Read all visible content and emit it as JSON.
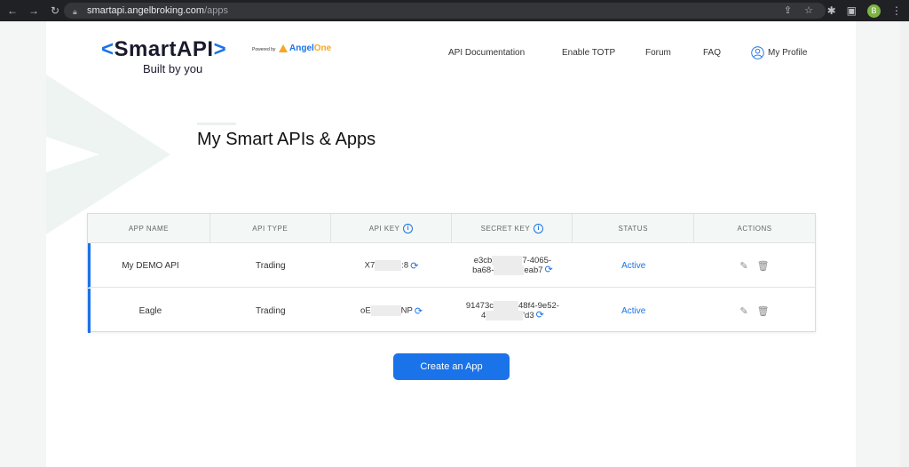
{
  "browser": {
    "url_host": "smartapi.angelbroking.com",
    "url_path": "/apps",
    "profile_initial": "B"
  },
  "logo": {
    "open_bracket": "<",
    "brand_smart": "Smart",
    "brand_api": "API",
    "close_bracket": ">",
    "tagline": "Built by you",
    "powered_by": "Powered by",
    "angel_part1": "Angel",
    "angel_part2": "One"
  },
  "nav": {
    "api_documentation": "API Documentation",
    "enable_totp": "Enable TOTP",
    "forum": "Forum",
    "faq": "FAQ",
    "my_profile": "My Profile"
  },
  "page_title": "My Smart APIs & Apps",
  "table": {
    "headers": [
      "APP NAME",
      "API TYPE",
      "API KEY",
      "SECRET KEY",
      "STATUS",
      "ACTIONS"
    ],
    "rows": [
      {
        "app_name": "My DEMO API",
        "api_type": "Trading",
        "api_key_start": "X7",
        "api_key_end": ":8",
        "secret_line1_start": "e3cb",
        "secret_line1_end": "7-4065-",
        "secret_line2_start": "ba68-",
        "secret_line2_end": "eab7",
        "status": "Active"
      },
      {
        "app_name": "Eagle",
        "api_type": "Trading",
        "api_key_start": "oE",
        "api_key_end": "NP",
        "secret_line1_start": "91473c",
        "secret_line1_end": "48f4-9e52-",
        "secret_line2_start": "4",
        "secret_line2_end": "'d3",
        "status": "Active"
      }
    ]
  },
  "create_button": "Create an App",
  "colors": {
    "accent": "#1a73e8",
    "angel_orange": "#f5a623",
    "header_bg": "#f3f7f5"
  }
}
